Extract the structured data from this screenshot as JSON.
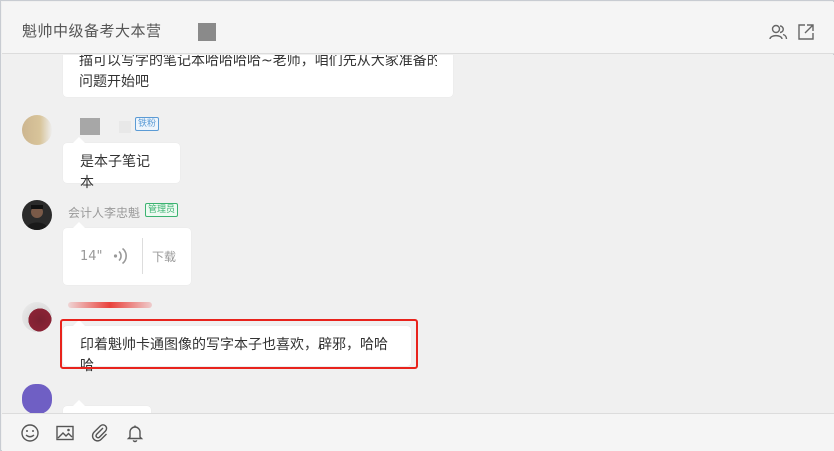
{
  "header": {
    "title": "魁帅中级备考大本营",
    "icons": [
      "group-members-icon",
      "open-external-icon"
    ]
  },
  "messages": [
    {
      "text_line1": "描可以写字的笔记本哈哈哈哈~老师，咱们先从大家准备的",
      "text_line2": "问题开始吧"
    },
    {
      "badge": "铁粉",
      "text": "是本子笔记本"
    },
    {
      "sender": "会计人李忠魁",
      "badge": "管理员",
      "voice_duration": "14\"",
      "voice_action": "下载"
    },
    {
      "text": "印着魁帅卡通图像的写字本子也喜欢，辟邪，哈哈哈"
    }
  ],
  "footer": {
    "icons": [
      "emoji-icon",
      "image-icon",
      "attachment-icon",
      "bell-icon"
    ]
  },
  "colors": {
    "highlight": "#e8231c",
    "badge_fan": "#5b9bd5",
    "badge_admin": "#3cb371"
  }
}
